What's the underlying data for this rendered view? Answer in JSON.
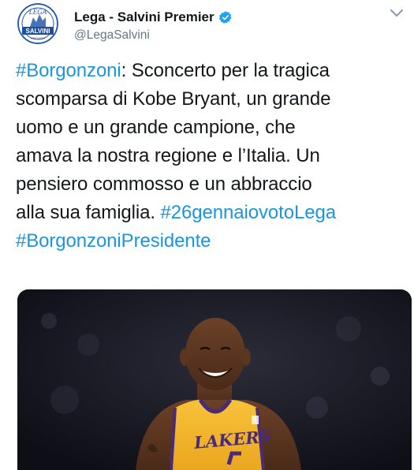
{
  "account": {
    "display_name": "Lega - Salvini Premier",
    "handle": "@LegaSalvini",
    "verified": true,
    "avatar": {
      "logo_text_top": "LEGA",
      "logo_text_banner": "SALVINI",
      "logo_text_small": "PREMIER"
    }
  },
  "tweet": {
    "lines": [
      [
        {
          "text": "#Borgonzoni",
          "type": "hashtag"
        },
        {
          "text": ": Sconcerto per la tragica",
          "type": "text"
        }
      ],
      [
        {
          "text": "scomparsa di Kobe Bryant, un grande",
          "type": "text"
        }
      ],
      [
        {
          "text": "uomo e un grande campione, che",
          "type": "text"
        }
      ],
      [
        {
          "text": "amava la nostra regione e l’Italia. Un",
          "type": "text"
        }
      ],
      [
        {
          "text": "pensiero commosso e un abbraccio",
          "type": "text"
        }
      ],
      [
        {
          "text": "alla sua famiglia. ",
          "type": "text"
        },
        {
          "text": "#26gennaiovotoLega",
          "type": "hashtag"
        }
      ],
      [
        {
          "text": " #BorgonzoniPresidente",
          "type": "hashtag"
        }
      ]
    ]
  },
  "media": {
    "jersey_text": "LAKERS",
    "description_icon": "photo-basketball-player"
  },
  "colors": {
    "hashtag": "#1b95e0",
    "verified": "#1da1f2",
    "handle": "#657786",
    "jersey_gold": "#f5b82e",
    "jersey_purple": "#4a2a7a"
  },
  "icons": {
    "verified": "verified-badge-icon",
    "menu": "chevron-down-icon"
  }
}
